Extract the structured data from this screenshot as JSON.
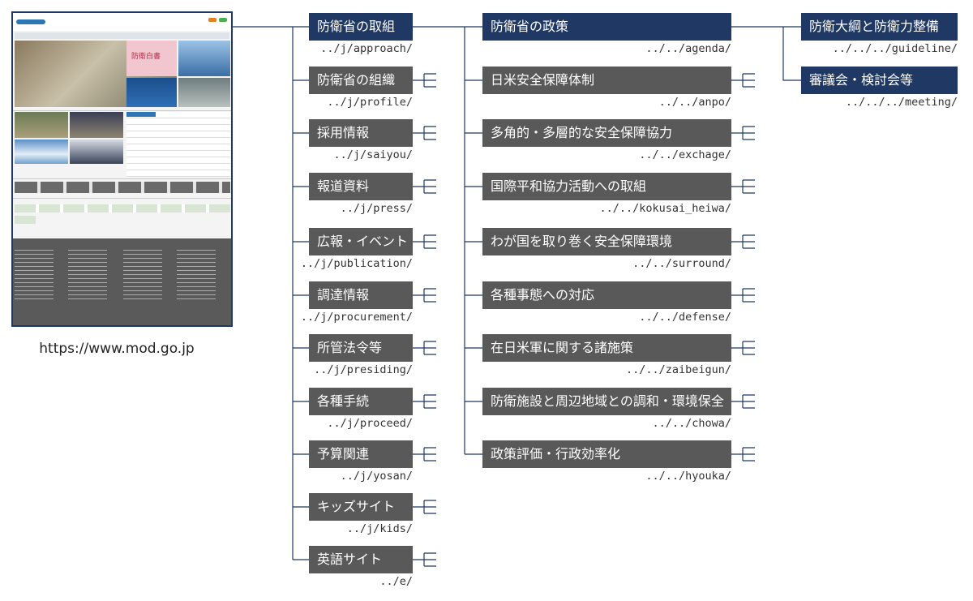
{
  "site": {
    "url": "https://www.mod.go.jp",
    "thumbnail_title": "防衛省・自衛隊",
    "thumbnail_banner_text": "防衛白書"
  },
  "tree": {
    "root": {
      "label": "防衛省の取組",
      "path": "../j/approach/"
    },
    "level1": [
      {
        "label": "防衛省の組織",
        "path": "../j/profile/"
      },
      {
        "label": "採用情報",
        "path": "../j/saiyou/"
      },
      {
        "label": "報道資料",
        "path": "../j/press/"
      },
      {
        "label": "広報・イベント",
        "path": "../j/publication/"
      },
      {
        "label": "調達情報",
        "path": "../j/procurement/"
      },
      {
        "label": "所管法令等",
        "path": "../j/presiding/"
      },
      {
        "label": "各種手続",
        "path": "../j/proceed/"
      },
      {
        "label": "予算関連",
        "path": "../j/yosan/"
      },
      {
        "label": "キッズサイト",
        "path": "../j/kids/"
      },
      {
        "label": "英語サイト",
        "path": "../e/"
      }
    ],
    "policy": {
      "label": "防衛省の政策",
      "path": "../../agenda/"
    },
    "level2": [
      {
        "label": "日米安全保障体制",
        "path": "../../anpo/"
      },
      {
        "label": "多角的・多層的な安全保障協力",
        "path": "../../exchage/"
      },
      {
        "label": "国際平和協力活動への取組",
        "path": "../../kokusai_heiwa/"
      },
      {
        "label": "わが国を取り巻く安全保障環境",
        "path": "../../surround/"
      },
      {
        "label": "各種事態への対応",
        "path": "../../defense/"
      },
      {
        "label": "在日米軍に関する諸施策",
        "path": "../../zaibeigun/"
      },
      {
        "label": "防衛施設と周辺地域との調和・環境保全",
        "path": "../../chowa/"
      },
      {
        "label": "政策評価・行政効率化",
        "path": "../../hyouka/"
      }
    ],
    "level3": [
      {
        "label": "防衛大綱と防衛力整備",
        "path": "../../../guideline/"
      },
      {
        "label": "審議会・検討会等",
        "path": "../../../meeting/"
      }
    ]
  },
  "colors": {
    "root_box": "#1f3864",
    "child_box": "#595959",
    "connector": "#1f3864"
  }
}
